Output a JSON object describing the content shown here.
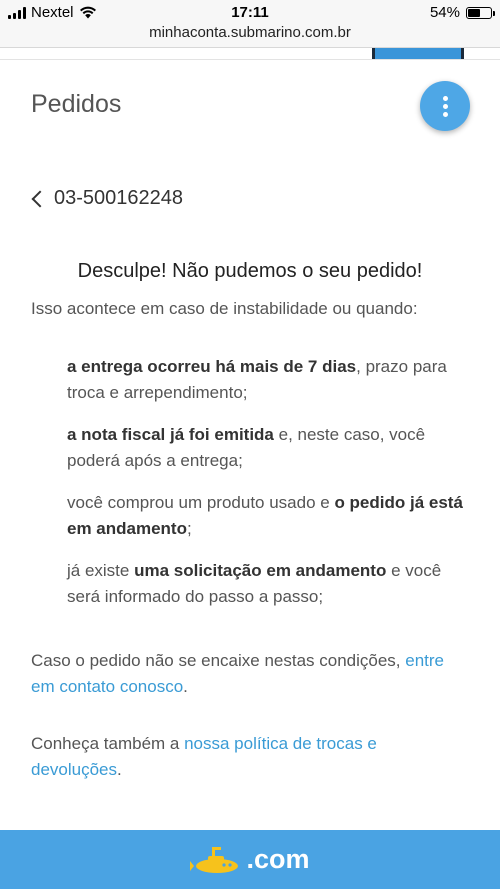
{
  "status_bar": {
    "carrier": "Nextel",
    "time": "17:11",
    "battery": "54%",
    "battery_level": 0.54
  },
  "address_bar": {
    "url": "minhaconta.submarino.com.br"
  },
  "header": {
    "title": "Pedidos",
    "menu_icon": "more-vertical-icon"
  },
  "order": {
    "back_icon": "chevron-left-icon",
    "number": "03-500162248"
  },
  "message": {
    "headline": "Desculpe! Não pudemos o seu pedido!",
    "intro": "Isso acontece em caso de instabilidade ou quando:",
    "reasons": [
      {
        "bold": "a entrega ocorreu há mais de 7 dias",
        "rest": ", prazo para troca e arrependimento;"
      },
      {
        "bold": "a nota fiscal já foi emitida",
        "rest": " e, neste caso, você poderá após a entrega;"
      },
      {
        "pre": "você comprou um produto usado e ",
        "bold": "o pedido já está em andamento",
        "rest": ";"
      },
      {
        "pre": "já existe ",
        "bold": "uma solicitação em andamento",
        "rest": " e você será informado do passo a passo;"
      }
    ],
    "contact_text": "Caso o pedido não se encaixe nestas condições, ",
    "contact_link": "entre em contato conosco",
    "contact_end": ".",
    "policy_text": "Conheça também a ",
    "policy_link": "nossa política de trocas e devoluções",
    "policy_end": "."
  },
  "footer": {
    "logo_text": ".com",
    "logo_icon": "submarine-icon",
    "color": "#4aa3e3"
  }
}
